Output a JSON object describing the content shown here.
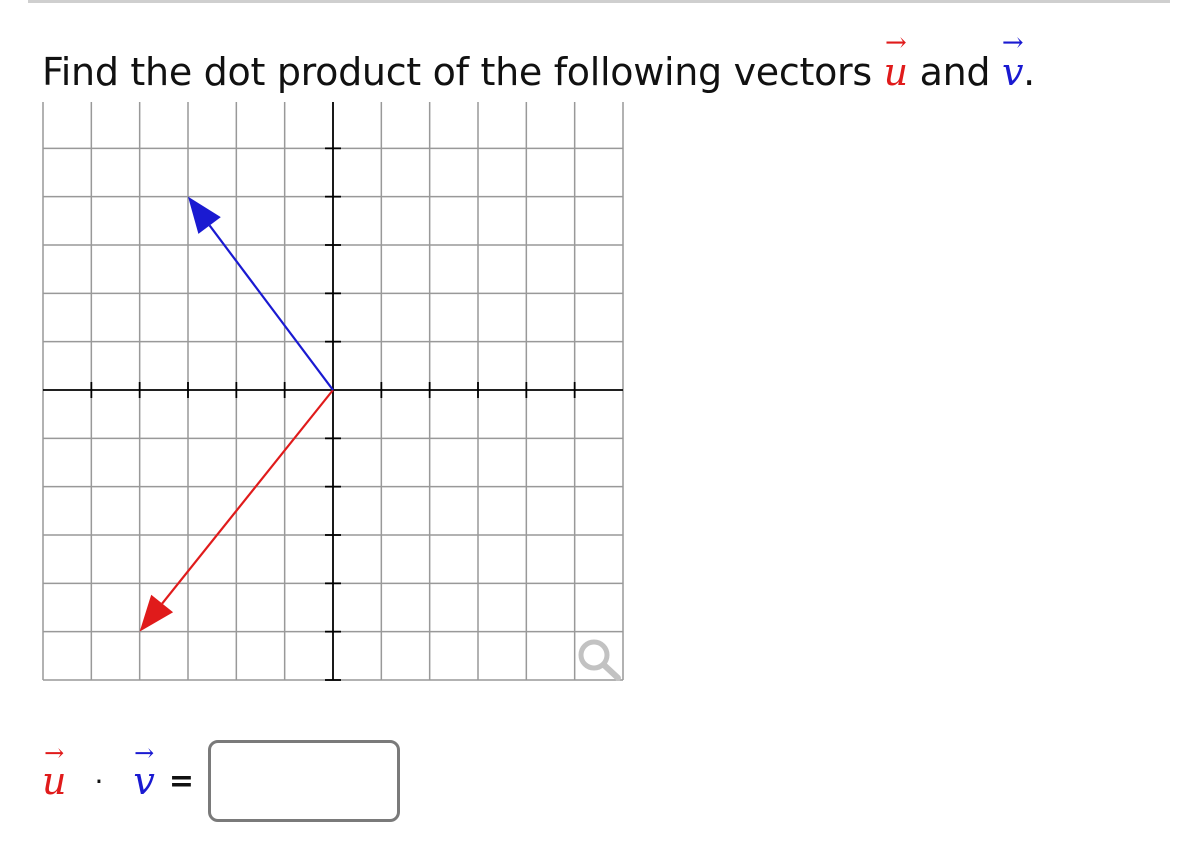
{
  "question": {
    "text": "Find the dot product of the following vectors",
    "conjunction": "and",
    "period": ".",
    "u_symbol": "u",
    "v_symbol": "v",
    "arrow_glyph": "→"
  },
  "graph": {
    "x_range": [
      -6,
      6
    ],
    "y_range": [
      -6,
      6
    ],
    "grid_step": 1,
    "vectors": [
      {
        "name": "u",
        "tail": [
          0,
          0
        ],
        "head": [
          -4,
          -5
        ],
        "color": "#e01b1b"
      },
      {
        "name": "v",
        "tail": [
          0,
          0
        ],
        "head": [
          -3,
          4
        ],
        "color": "#1a1ad1"
      }
    ],
    "zoom_icon": "magnifier-icon"
  },
  "answer": {
    "u_symbol": "u",
    "v_symbol": "v",
    "dot_operator": "·",
    "equals": "=",
    "arrow_glyph": "→",
    "input_value": "",
    "input_placeholder": ""
  },
  "colors": {
    "u": "#e01b1b",
    "v": "#1a1ad1",
    "grid": "#999999",
    "axis": "#000000"
  }
}
